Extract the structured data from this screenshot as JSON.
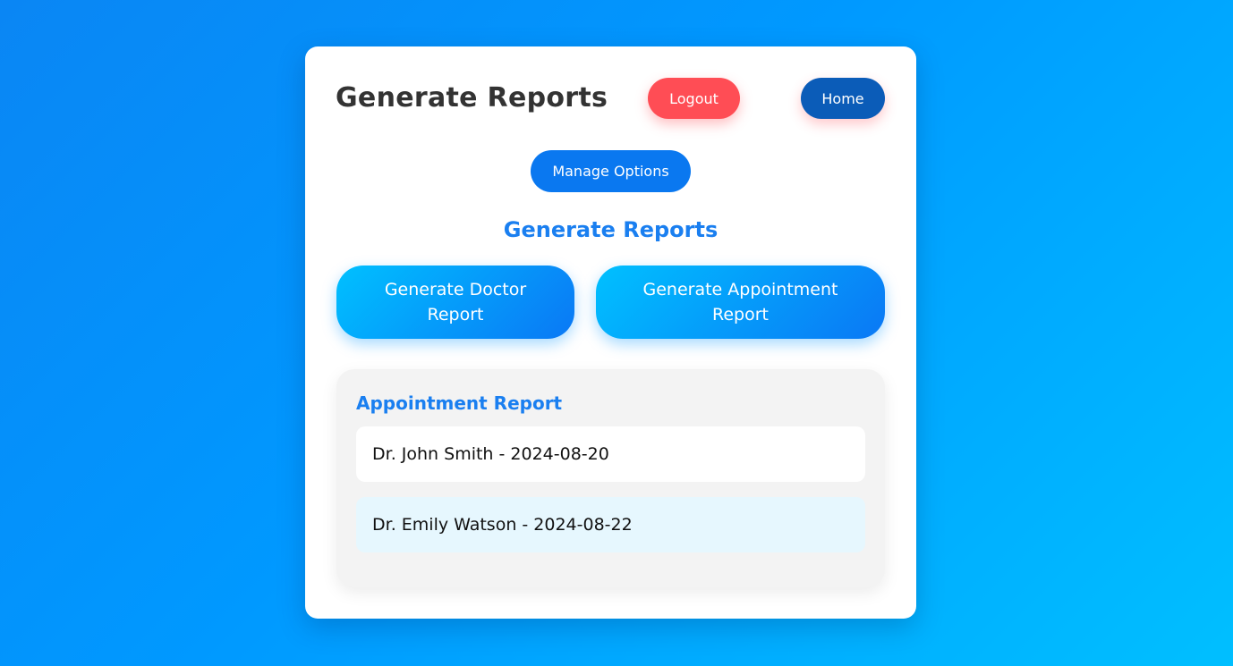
{
  "header": {
    "title": "Generate Reports",
    "logout_label": "Logout",
    "home_label": "Home"
  },
  "manage_label": "Manage Options",
  "section_title": "Generate Reports",
  "actions": {
    "doctor_report_label": "Generate Doctor Report",
    "appointment_report_label": "Generate Appointment Report"
  },
  "report": {
    "title": "Appointment Report",
    "items": [
      {
        "text": "Dr. John Smith - 2024-08-20"
      },
      {
        "text": "Dr. Emily Watson - 2024-08-22"
      }
    ]
  },
  "colors": {
    "logout": "#ff4d55",
    "home": "#0b5cb8",
    "primary": "#1a7ff0",
    "highlight_row": "#e6f7fe"
  }
}
